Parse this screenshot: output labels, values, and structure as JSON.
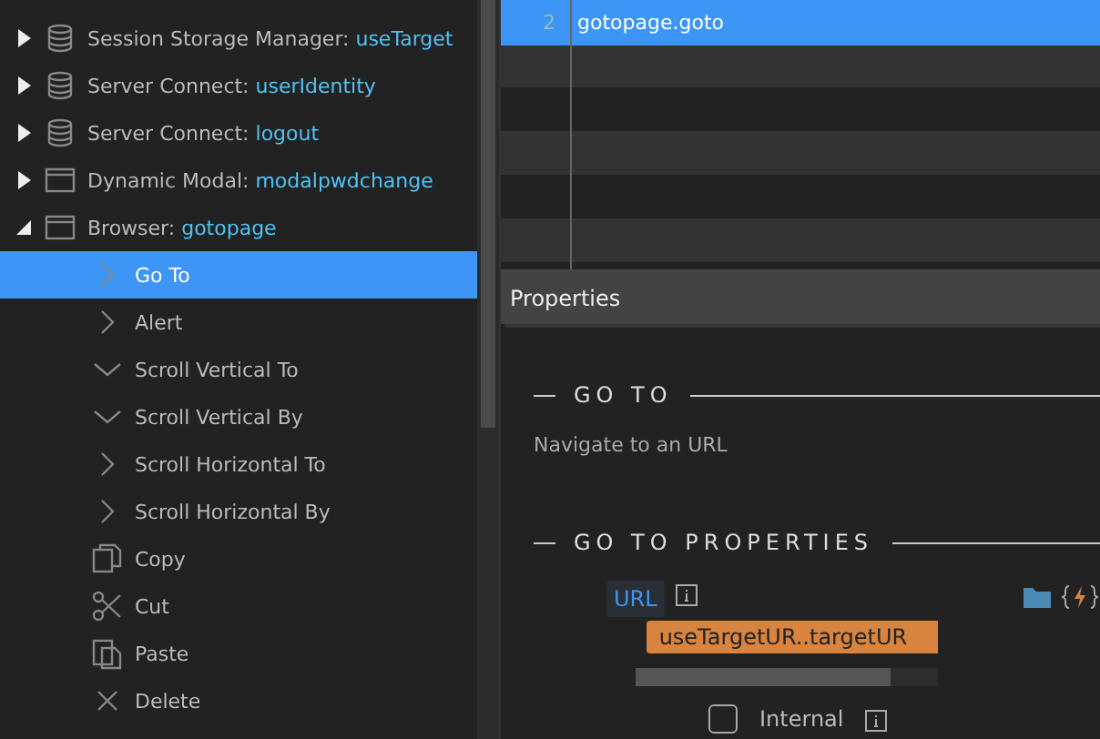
{
  "tree": [
    {
      "kind": "database",
      "type": "Session Storage Manager: ",
      "name": "useTarget",
      "expanded": false,
      "selected": false
    },
    {
      "kind": "database",
      "type": "Server Connect: ",
      "name": "userIdentity",
      "expanded": false,
      "selected": false
    },
    {
      "kind": "database",
      "type": "Server Connect: ",
      "name": "logout",
      "expanded": false,
      "selected": false
    },
    {
      "kind": "window",
      "type": "Dynamic Modal: ",
      "name": "modalpwdchange",
      "expanded": false,
      "selected": false
    },
    {
      "kind": "window",
      "type": "Browser: ",
      "name": "gotopage",
      "expanded": true,
      "selected": false,
      "children": [
        {
          "kind": "chevron-right",
          "label": "Go To",
          "selected": true
        },
        {
          "kind": "chevron-right",
          "label": "Alert",
          "selected": false
        },
        {
          "kind": "chevron-down",
          "label": "Scroll Vertical To",
          "selected": false
        },
        {
          "kind": "chevron-down",
          "label": "Scroll Vertical By",
          "selected": false
        },
        {
          "kind": "chevron-right",
          "label": "Scroll Horizontal To",
          "selected": false
        },
        {
          "kind": "chevron-right",
          "label": "Scroll Horizontal By",
          "selected": false
        },
        {
          "kind": "copy",
          "label": "Copy",
          "selected": false
        },
        {
          "kind": "cut",
          "label": "Cut",
          "selected": false
        },
        {
          "kind": "paste",
          "label": "Paste",
          "selected": false
        },
        {
          "kind": "delete",
          "label": "Delete",
          "selected": false
        }
      ]
    }
  ],
  "code": {
    "lines": [
      {
        "number": "2",
        "text": "gotopage.goto",
        "selected": true
      }
    ]
  },
  "properties": {
    "title": "Properties",
    "sections": [
      {
        "heading": "GO TO",
        "description": "Navigate to an URL"
      },
      {
        "heading": "GO TO PROPERTIES"
      }
    ],
    "url_field": {
      "label": "URL",
      "value": "useTargetUR..targetUR"
    },
    "internal": {
      "label": "Internal",
      "checked": false
    }
  }
}
